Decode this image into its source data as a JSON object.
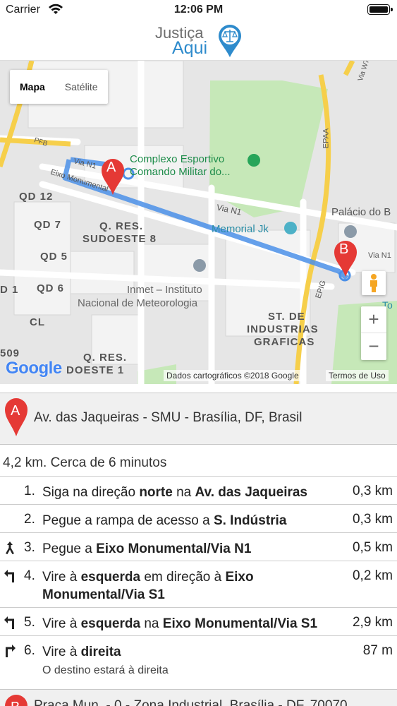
{
  "status_bar": {
    "carrier": "Carrier",
    "time": "12:06 PM"
  },
  "logo": {
    "line1": "Justiça",
    "line2": "Aqui"
  },
  "map": {
    "type_buttons": [
      "Mapa",
      "Satélite"
    ],
    "labels": {
      "complexo1": "Complexo Esportivo",
      "complexo2": "Comando Militar do...",
      "via_n1_top": "Via N1",
      "eixo": "Eixo Monumental",
      "pfb": "PFB",
      "qd12": "QD 12",
      "qd7": "QD 7",
      "qd5": "QD 5",
      "qd6": "QD 6",
      "d1": "D 1",
      "cl": "CL",
      "n509": "509",
      "qres1": "Q. RES.",
      "sudoeste8": "SUDOESTE 8",
      "qres2": "Q. RES.",
      "sudoeste1": "DOESTE 1",
      "via_n1_mid": "Via N1",
      "memorial": "Memorial Jk",
      "inmet1": "Inmet – Instituto",
      "inmet2": "Nacional de Meteorologia",
      "st1": "ST. DE",
      "st2": "INDUSTRIAS",
      "st3": "GRAFICAS",
      "palacio": "Palácio do B",
      "via_n1_right": "Via N1",
      "epaa": "EPAA",
      "epig": "EPIG",
      "to": "To",
      "n": "N",
      "via_w7": "Via W7"
    },
    "marker_a": "A",
    "marker_b": "B",
    "google": "Google",
    "credits": "Dados cartográficos ©2018 Google",
    "terms": "Termos de Uso",
    "zoom_in": "+",
    "zoom_out": "−"
  },
  "origin": {
    "marker": "A",
    "address": "Av. das Jaqueiras - SMU - Brasília, DF, Brasil"
  },
  "summary": "4,2 km. Cerca de 6 minutos",
  "steps": [
    {
      "num": "1.",
      "icon": "none",
      "parts": [
        "Siga na direção ",
        "norte",
        " na ",
        "Av. das Jaqueiras"
      ],
      "distance": "0,3 km"
    },
    {
      "num": "2.",
      "icon": "none",
      "parts": [
        "Pegue a rampa de acesso a ",
        "S. Indústria"
      ],
      "distance": "0,3 km"
    },
    {
      "num": "3.",
      "icon": "merge-icon",
      "parts": [
        "Pegue a ",
        "Eixo Monumental/Via N1"
      ],
      "distance": "0,5 km"
    },
    {
      "num": "4.",
      "icon": "turn-left-icon",
      "parts": [
        "Vire à ",
        "esquerda",
        " em direção à ",
        "Eixo Monumental/Via S1"
      ],
      "distance": "0,2 km"
    },
    {
      "num": "5.",
      "icon": "turn-left-icon",
      "parts": [
        "Vire à ",
        "esquerda",
        " na ",
        "Eixo Monumental/Via S1"
      ],
      "distance": "2,9 km"
    },
    {
      "num": "6.",
      "icon": "turn-right-icon",
      "parts": [
        "Vire à ",
        "direita"
      ],
      "note": "O destino estará à direita",
      "distance": "87 m"
    }
  ],
  "destination": {
    "marker": "B",
    "address": "Praça Mun. - 0 - Zona Industrial, Brasília - DF, 70070"
  },
  "colors": {
    "route": "#4a8fe7",
    "marker": "#e53935",
    "park": "#c6e8b8",
    "road_yellow": "#f6cf4b",
    "logo_blue": "#2e8bcc"
  }
}
